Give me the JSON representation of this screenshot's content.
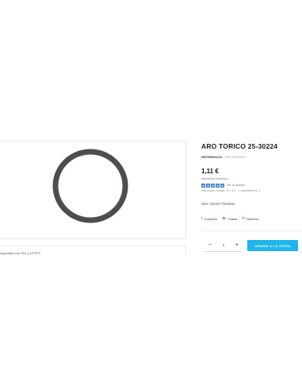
{
  "product": {
    "title": "ARO TORICO 25-30224",
    "reference_label": "REFERENCIA:",
    "reference_value": "ORC25-30224",
    "price": "1,11 €",
    "tax_note": "Impuestos incluidos",
    "rating": {
      "stars": 5,
      "max": 5,
      "link_text": "Ver la opinión",
      "summary": "Valoración media: 10 / 10 · 1 valoraciones: 1"
    },
    "oem_codes": "OHC 310327 F910582",
    "footer_note": "seguridad con SSL y HTTPS"
  },
  "share": {
    "items": [
      {
        "icon": "facebook-icon",
        "glyph": "f",
        "label": "Compartir"
      },
      {
        "icon": "twitter-icon",
        "glyph": "🐦",
        "label": "Tuitear"
      },
      {
        "icon": "pinterest-icon",
        "glyph": "P",
        "label": "Pinterest"
      }
    ]
  },
  "cart": {
    "quantity": "1",
    "decrement_glyph": "−",
    "increment_glyph": "+",
    "add_label": "AÑADIR A LA CESTA"
  },
  "colors": {
    "accent": "#1fb5ec",
    "star": "#3f7fd0",
    "ring": "#4b4e4c"
  }
}
